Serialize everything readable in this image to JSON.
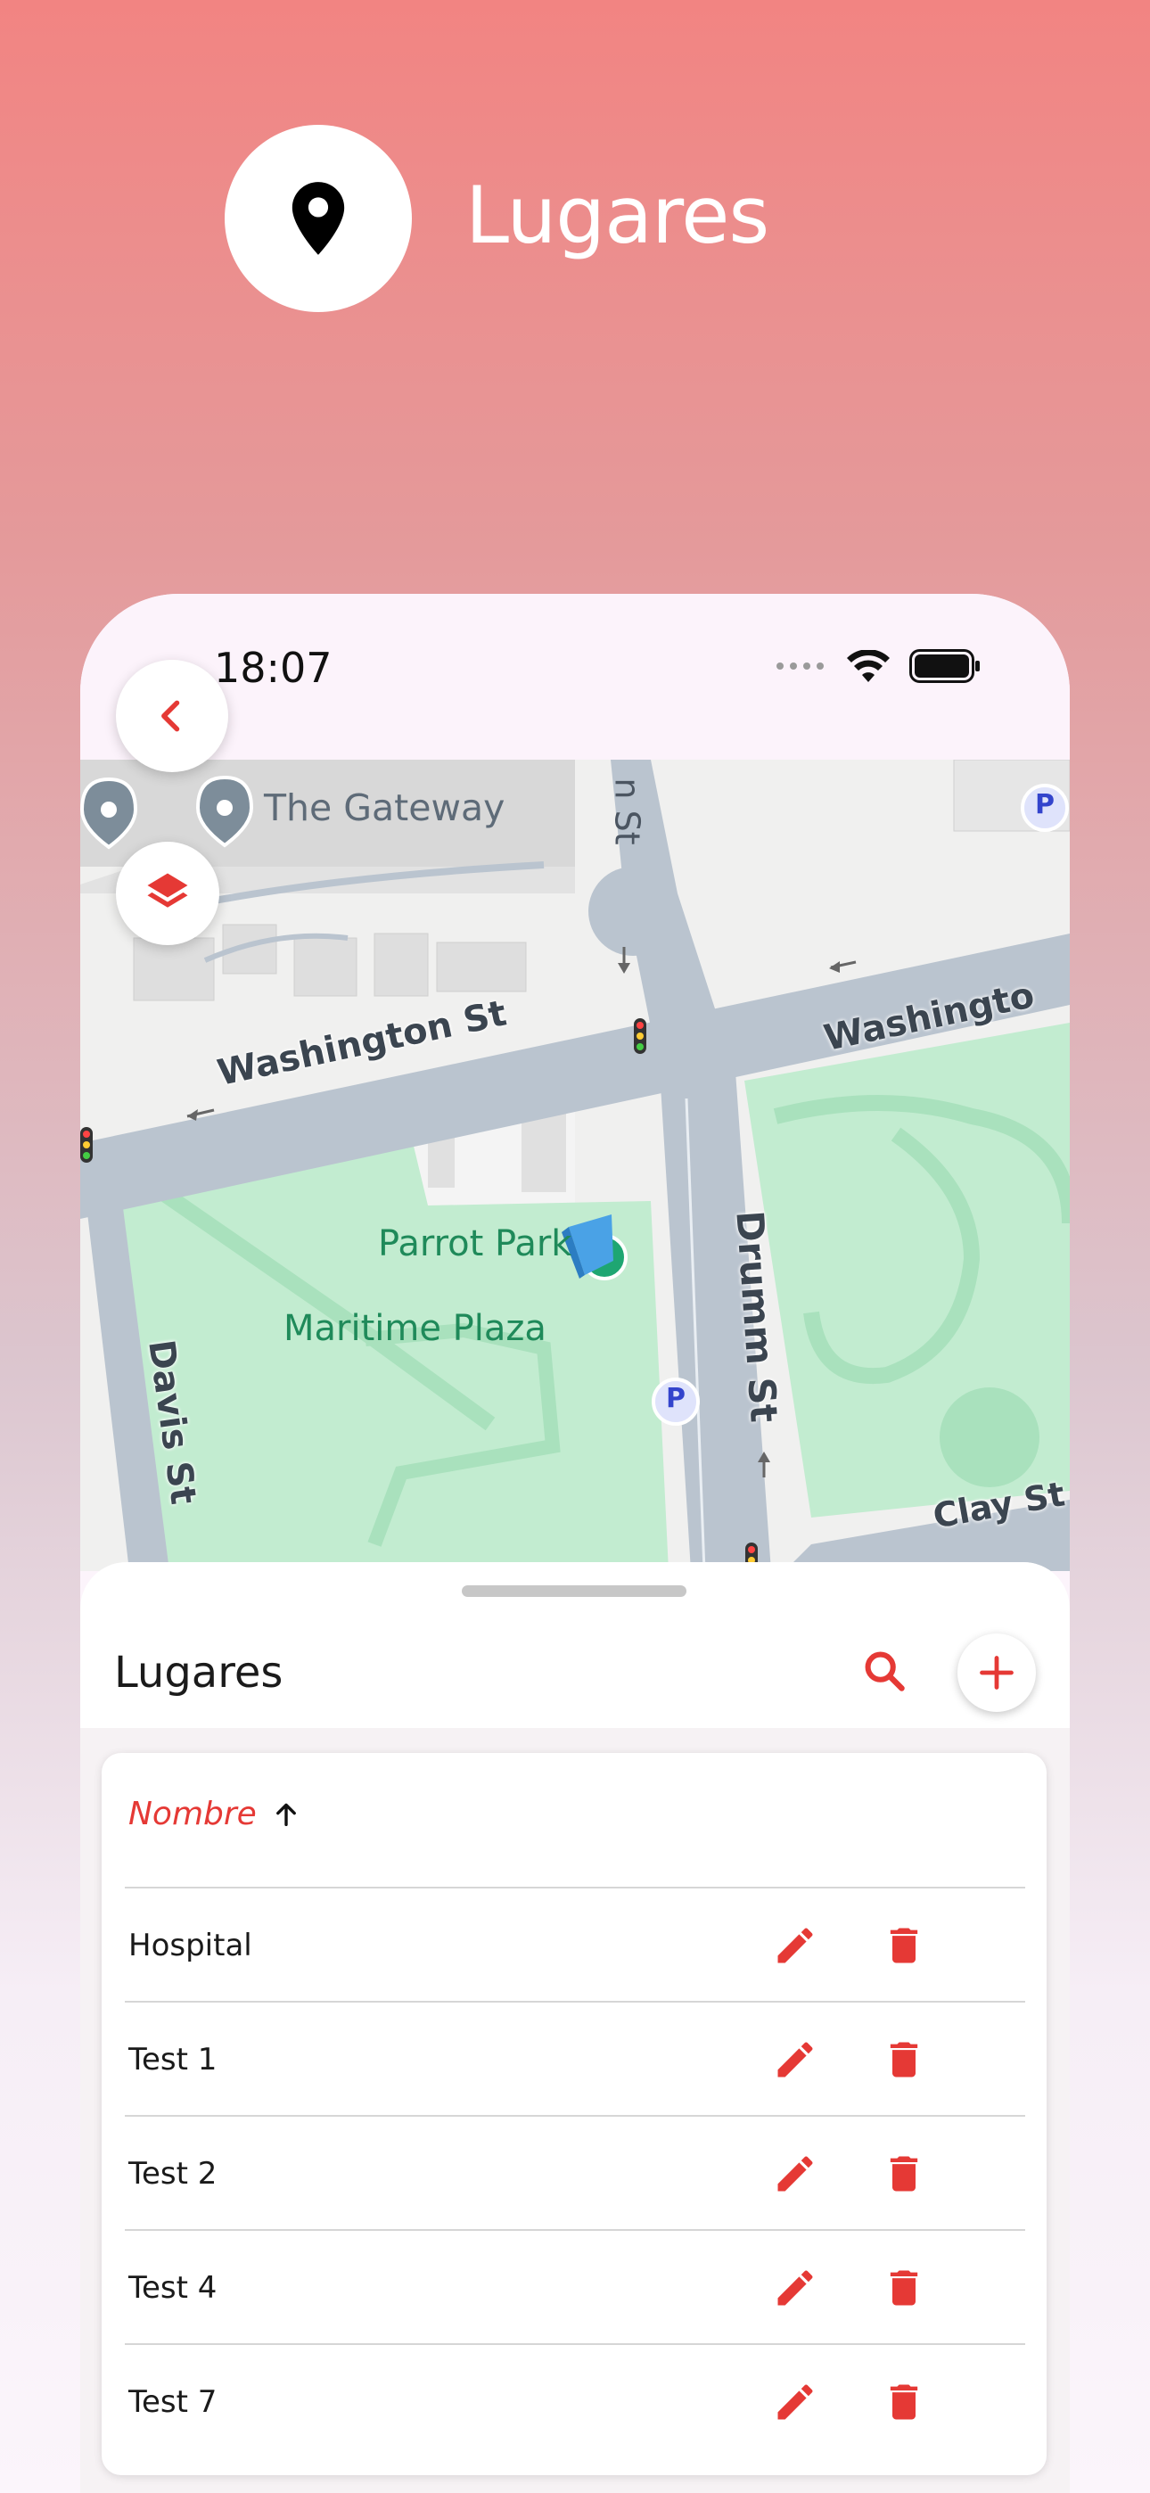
{
  "hero": {
    "title": "Lugares",
    "icon": "location-pin-icon"
  },
  "status_bar": {
    "time": "18:07"
  },
  "map": {
    "labels": {
      "the_gateway": "The Gateway",
      "washington_st": "Washington St",
      "washington_st_right": "Washingto",
      "parrot_park": "Parrot Park",
      "maritime_plaza": "Maritime Plaza",
      "davis_st": "Davis St",
      "drumm_st": "Drumm St",
      "clay_st": "Clay St",
      "top_street_fragment": "n St",
      "parking": "P"
    }
  },
  "sheet": {
    "title": "Lugares",
    "table": {
      "column_header": "Nombre",
      "sort_direction": "ascending",
      "rows": [
        {
          "name": "Hospital"
        },
        {
          "name": "Test 1"
        },
        {
          "name": "Test 2"
        },
        {
          "name": "Test 4"
        },
        {
          "name": "Test 7"
        }
      ]
    }
  },
  "colors": {
    "accent": "#e53935",
    "park_green": "#c2ecd0",
    "road": "#bac4cf"
  }
}
